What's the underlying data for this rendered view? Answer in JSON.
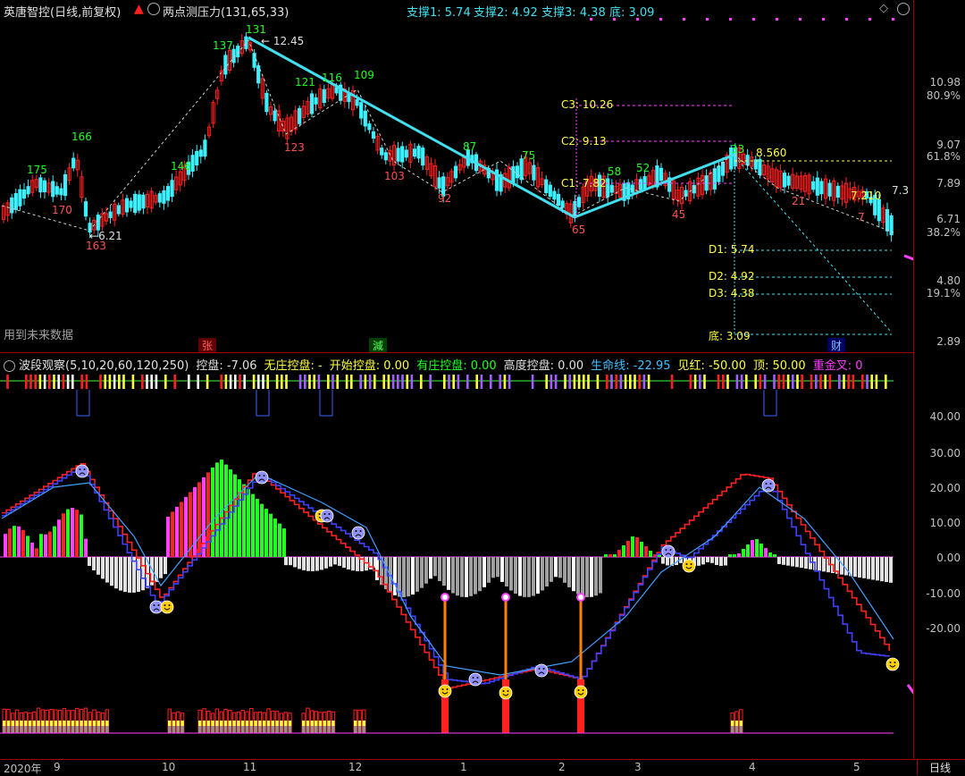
{
  "header": {
    "stock_name": "英唐智控(日线,前复权)",
    "indicator_name": "两点测压力(131,65,33)",
    "support1": "支撑1: 5.74",
    "support2": "支撑2: 4.92",
    "support3": "支撑3: 4.38",
    "bottom": "底: 3.09"
  },
  "price_axis": {
    "labels": [
      "10.98",
      "80.9%",
      "9.07",
      "61.8%",
      "7.89",
      "6.71",
      "38.2%",
      "4.80",
      "19.1%",
      "2.89"
    ]
  },
  "price_annotations": {
    "peak_label": "131",
    "peak_price": "12.45",
    "low_label": "163",
    "low_price": "6.21",
    "c3": "C3: 10.26",
    "c2": "C2: 9.13",
    "c1": "C1: 7.82",
    "d1": "D1: 5.74",
    "d2": "D2: 4.92",
    "d3": "D3: 4.38",
    "di": "底: 3.09",
    "right_price": "8.560",
    "right_price2": "7.210",
    "right_price3": "7.3",
    "future_data": "用到未来数据",
    "tag_zhang": "张",
    "tag_jian": "減",
    "tag_cai": "财",
    "wave_labels": [
      "175",
      "170",
      "166",
      "146",
      "137",
      "123",
      "121",
      "116",
      "109",
      "103",
      "92",
      "87",
      "75",
      "65",
      "58",
      "52",
      "45",
      "33",
      "21",
      "7"
    ]
  },
  "indicator": {
    "title": "波段观察(5,10,20,60,120,250)",
    "kongpan": "控盘: -7.06",
    "wuzhuang": "无庄控盘: -",
    "kaishi": "开始控盘: 0.00",
    "youzhuang": "有庄控盘: 0.00",
    "gaodu": "高度控盘: 0.00",
    "shengming": "生命线: -22.95",
    "jianhong": "见红: -50.00",
    "ding": "顶: 50.00",
    "jincha": "重金叉: 0"
  },
  "ind_axis": {
    "labels": [
      "40.00",
      "30.00",
      "20.00",
      "10.00",
      "0.00",
      "-10.00",
      "-20.00"
    ]
  },
  "time_axis": {
    "labels": [
      "2020年",
      "9",
      "10",
      "11",
      "12",
      "1",
      "2",
      "3",
      "4",
      "5"
    ],
    "period": "日线"
  },
  "colors": {
    "up": "#ff2020",
    "down": "#3cf0ff",
    "trend": "#40e0f0",
    "magenta": "#ff40ff",
    "yellow": "#ffff40",
    "green": "#20ff20",
    "accent_red": "#a00000"
  }
}
